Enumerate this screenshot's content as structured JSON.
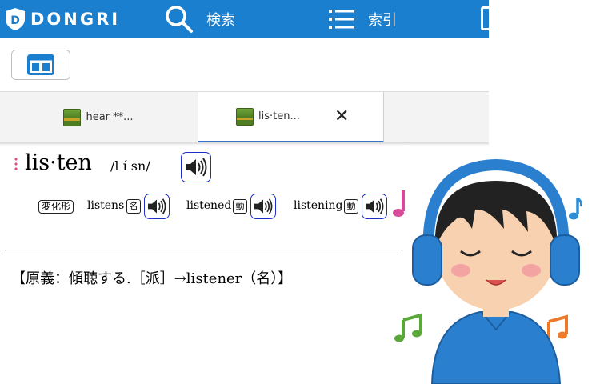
{
  "header": {
    "logo_text": "DONGRI",
    "search_label": "検索",
    "index_label": "索引"
  },
  "tabs": [
    {
      "label": "hear **...",
      "active": false
    },
    {
      "label": "lis·ten...",
      "active": true
    }
  ],
  "entry": {
    "headword": "lis·ten",
    "pronunciation": "/l ı́ sn/",
    "forms_badge": "変化形",
    "forms": [
      {
        "word": "listens",
        "pos": "名"
      },
      {
        "word": "listened",
        "pos": "動"
      },
      {
        "word": "listening",
        "pos": "動"
      }
    ],
    "etymology": "【原義：傾聴する.［派］→listener（名）】"
  },
  "colors": {
    "header_bg": "#1b7fd0",
    "speaker_border": "#1f2fc9",
    "active_tab_underline": "#3b6fc6"
  }
}
